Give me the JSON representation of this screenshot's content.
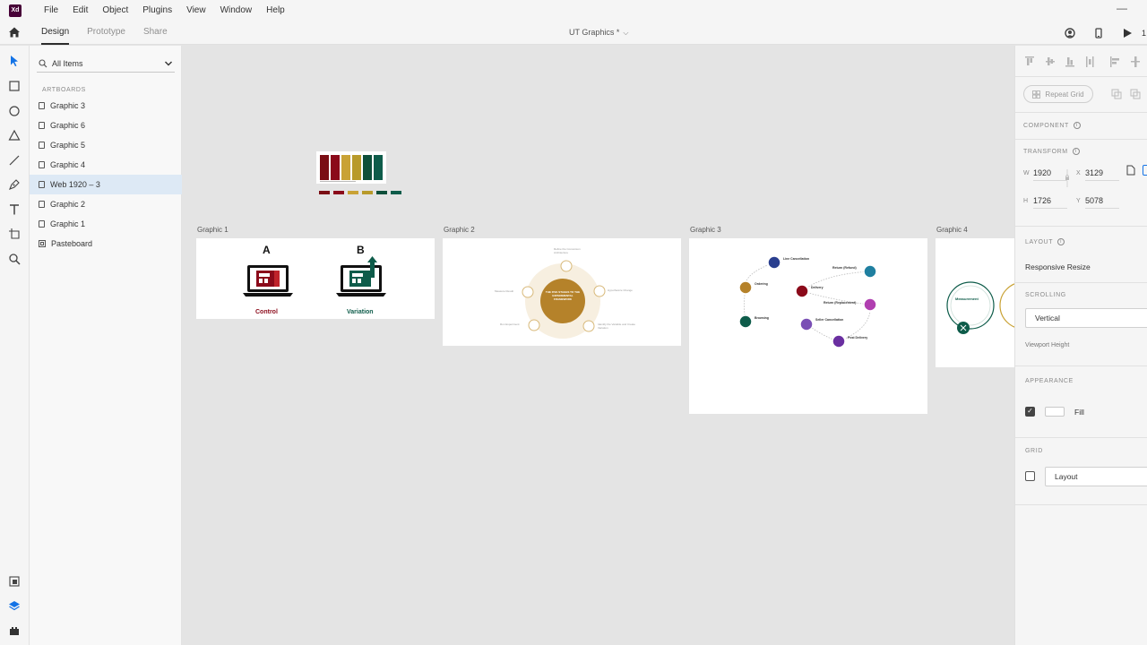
{
  "app": {
    "logo_text": "Xd",
    "logo_color": "#470137"
  },
  "menubar": {
    "items": [
      "File",
      "Edit",
      "Object",
      "Plugins",
      "View",
      "Window",
      "Help"
    ],
    "minimize": "—"
  },
  "topbar": {
    "tabs": [
      "Design",
      "Prototype",
      "Share"
    ],
    "active_tab": "Design",
    "document_title": "UT Graphics *",
    "zoom_partial": "1"
  },
  "layers": {
    "search_label": "All Items",
    "artboards_heading": "ARTBOARDS",
    "items": [
      {
        "label": "Graphic 3"
      },
      {
        "label": "Graphic 6"
      },
      {
        "label": "Graphic 5"
      },
      {
        "label": "Graphic 4"
      },
      {
        "label": "Web 1920 – 3",
        "selected": true
      },
      {
        "label": "Graphic 2"
      },
      {
        "label": "Graphic 1"
      },
      {
        "label": "Pasteboard",
        "pasteboard": true
      }
    ]
  },
  "canvas": {
    "artboards": [
      {
        "label": "Graphic 1"
      },
      {
        "label": "Graphic 2"
      },
      {
        "label": "Graphic 3"
      },
      {
        "label": "Graphic 4"
      }
    ],
    "graphic1": {
      "a_label": "A",
      "b_label": "B",
      "control_label": "Control",
      "variation_label": "Variation",
      "control_color": "#8b0a1a",
      "variation_color": "#0e5c4a"
    },
    "graphic2": {
      "center_text": "THE FIVE STAGES TO THE EXPERIMENTAL FRAMEWORK",
      "accent": "#b5822a",
      "stages": [
        "Refine the Conversion Architecture",
        "Hypothesize Change",
        "Identify the Variable and Create Variation",
        "Run Experiment",
        "Measure Result"
      ]
    },
    "graphic3": {
      "nodes": [
        {
          "title": "Line Cancellation",
          "color": "#2a3f8f"
        },
        {
          "title": "Ordering",
          "color": "#b5822a"
        },
        {
          "title": "Delivery",
          "color": "#8b0a1a"
        },
        {
          "title": "Return (Refund)",
          "color": "#1f7fa0"
        },
        {
          "title": "Return (Replacement)",
          "color": "#b03fb0"
        },
        {
          "title": "Browsing",
          "color": "#0e5c4a"
        },
        {
          "title": "Seller Cancellation",
          "color": "#7a4fb5"
        },
        {
          "title": "Post Delivery",
          "color": "#6a2fa0"
        }
      ]
    },
    "graphic4": {
      "title": "Measurement",
      "color": "#0e5c4a"
    },
    "swatches": [
      "#7a0e14",
      "#8b0a1a",
      "#c9a235",
      "#b89a2a",
      "#0e4f3a",
      "#0e5c4a"
    ]
  },
  "props": {
    "component_heading": "COMPONENT",
    "transform_heading": "TRANSFORM",
    "repeat_grid": "Repeat Grid",
    "w_label": "W",
    "w_value": "1920",
    "x_label": "X",
    "x_value": "3129",
    "h_label": "H",
    "h_value": "1726",
    "y_label": "Y",
    "y_value": "5078",
    "layout_heading": "LAYOUT",
    "responsive_resize": "Responsive Resize",
    "scrolling_heading": "SCROLLING",
    "scrolling_value": "Vertical",
    "viewport_height": "Viewport Height",
    "appearance_heading": "APPEARANCE",
    "fill_label": "Fill",
    "grid_heading": "GRID",
    "grid_value": "Layout"
  }
}
